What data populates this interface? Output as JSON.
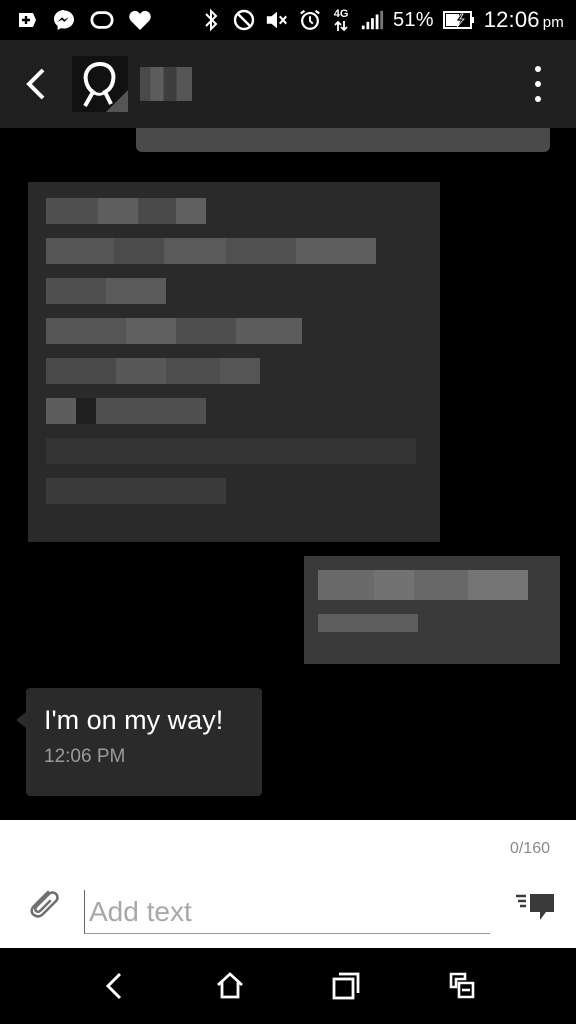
{
  "status_bar": {
    "battery_percent": "51%",
    "time": "12:06",
    "time_suffix": "pm",
    "network_label": "4G",
    "icons": [
      "add-icon",
      "messenger-icon",
      "oval-icon",
      "heart-icon",
      "bluetooth-icon",
      "do-not-disturb-icon",
      "mute-icon",
      "alarm-icon",
      "4g-icon",
      "signal-icon",
      "battery-charging-icon"
    ]
  },
  "app_bar": {
    "back_icon": "chevron-left-icon",
    "menu_icon": "overflow-menu-icon"
  },
  "conversation": {
    "last_message": {
      "text": "I'm on my way!",
      "time": "12:06 PM"
    }
  },
  "composer": {
    "char_count": "0/160",
    "placeholder": "Add text",
    "attach_icon": "paperclip-icon",
    "send_icon": "send-icon"
  },
  "nav_bar": {
    "buttons": [
      "back-icon",
      "home-icon",
      "recents-icon",
      "screenshot-icon"
    ]
  },
  "colors": {
    "background": "#000000",
    "app_bar": "#202020",
    "bubble": "#2a2a2a",
    "composer": "#ffffff"
  }
}
